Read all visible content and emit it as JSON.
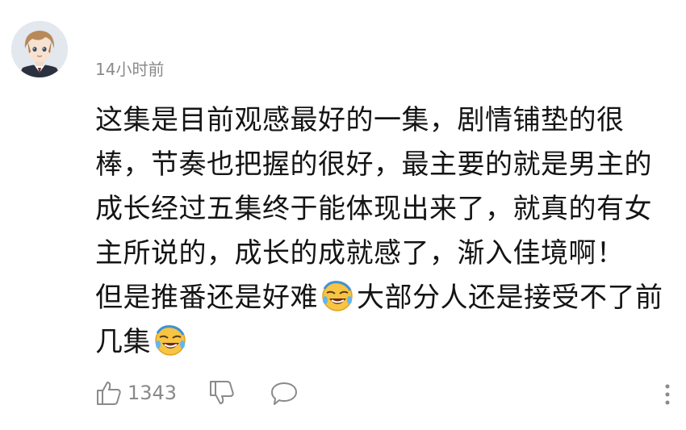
{
  "comment": {
    "time_label": "14小时前",
    "body_segment_1": "这集是目前观感最好的一集，剧情铺垫的很棒，节奏也把握的很好，最主要的就是男主的成长经过五集终于能体现出来了，就真的有女主所说的，成长的成就感了，渐入佳境啊！",
    "body_segment_2": "但是推番还是好难",
    "body_segment_3": "大部分人还是接受不了前几集",
    "emoji_1": "laugh-cry-emoji",
    "emoji_2": "laugh-cry-emoji",
    "like_count": "1343",
    "icons": {
      "like": "thumbs-up-icon",
      "dislike": "thumbs-down-icon",
      "reply": "speech-bubble-icon",
      "more": "more-vertical-icon"
    },
    "colors": {
      "text": "#141414",
      "meta": "#8a8a8a",
      "emoji_face": "#f7c443"
    }
  }
}
